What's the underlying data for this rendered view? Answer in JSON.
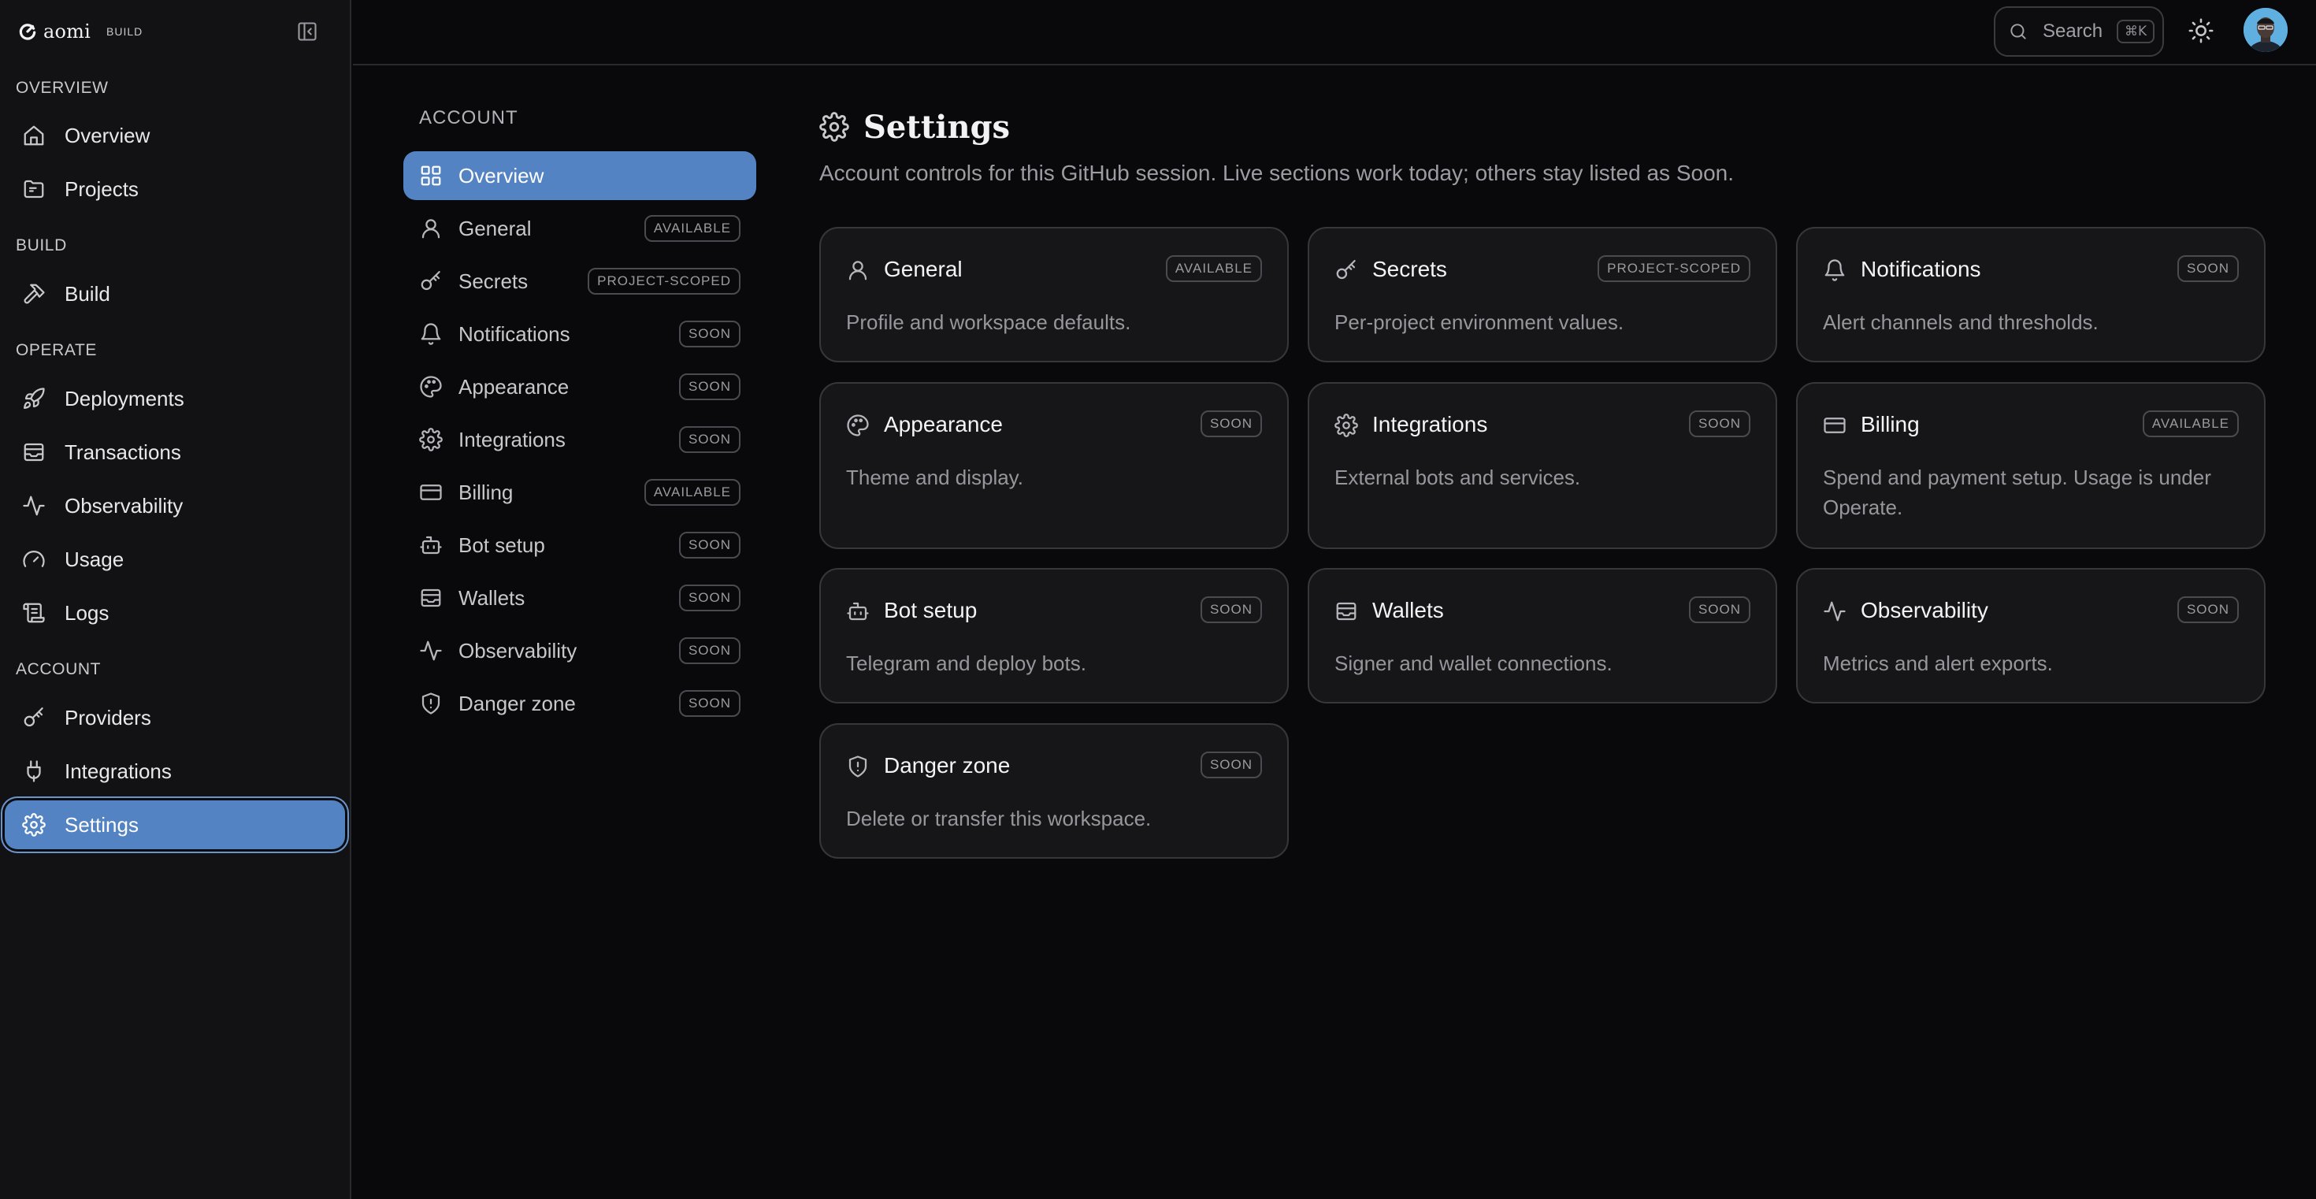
{
  "brand": {
    "name": "aomi",
    "tag": "BUILD"
  },
  "sidebar": {
    "groups": [
      {
        "label": "OVERVIEW"
      },
      {
        "label": "BUILD"
      },
      {
        "label": "OPERATE"
      },
      {
        "label": "ACCOUNT"
      }
    ],
    "items": [
      {
        "label": "Overview",
        "icon": "home-icon"
      },
      {
        "label": "Projects",
        "icon": "folder-icon"
      },
      {
        "label": "Build",
        "icon": "hammer-icon"
      },
      {
        "label": "Deployments",
        "icon": "rocket-icon"
      },
      {
        "label": "Transactions",
        "icon": "inbox-icon"
      },
      {
        "label": "Observability",
        "icon": "activity-icon"
      },
      {
        "label": "Usage",
        "icon": "gauge-icon"
      },
      {
        "label": "Logs",
        "icon": "scroll-icon"
      },
      {
        "label": "Providers",
        "icon": "key-icon"
      },
      {
        "label": "Integrations",
        "icon": "plug-icon"
      },
      {
        "label": "Settings",
        "icon": "gear-icon",
        "active": true
      }
    ]
  },
  "topbar": {
    "search_label": "Search",
    "search_shortcut": "⌘K"
  },
  "subnav": {
    "heading": "ACCOUNT",
    "items": [
      {
        "label": "Overview",
        "badge": "",
        "active": true
      },
      {
        "label": "General",
        "badge": "AVAILABLE"
      },
      {
        "label": "Secrets",
        "badge": "PROJECT-SCOPED"
      },
      {
        "label": "Notifications",
        "badge": "SOON"
      },
      {
        "label": "Appearance",
        "badge": "SOON"
      },
      {
        "label": "Integrations",
        "badge": "SOON"
      },
      {
        "label": "Billing",
        "badge": "AVAILABLE"
      },
      {
        "label": "Bot setup",
        "badge": "SOON"
      },
      {
        "label": "Wallets",
        "badge": "SOON"
      },
      {
        "label": "Observability",
        "badge": "SOON"
      },
      {
        "label": "Danger zone",
        "badge": "SOON"
      }
    ]
  },
  "main": {
    "title": "Settings",
    "subtitle": "Account controls for this GitHub session. Live sections work today; others stay listed as Soon.",
    "cards": [
      {
        "title": "General",
        "badge": "AVAILABLE",
        "desc": "Profile and workspace defaults."
      },
      {
        "title": "Secrets",
        "badge": "PROJECT-SCOPED",
        "desc": "Per-project environment values."
      },
      {
        "title": "Notifications",
        "badge": "SOON",
        "desc": "Alert channels and thresholds."
      },
      {
        "title": "Appearance",
        "badge": "SOON",
        "desc": "Theme and display."
      },
      {
        "title": "Integrations",
        "badge": "SOON",
        "desc": "External bots and services."
      },
      {
        "title": "Billing",
        "badge": "AVAILABLE",
        "desc": "Spend and payment setup. Usage is under Operate."
      },
      {
        "title": "Bot setup",
        "badge": "SOON",
        "desc": "Telegram and deploy bots."
      },
      {
        "title": "Wallets",
        "badge": "SOON",
        "desc": "Signer and wallet connections."
      },
      {
        "title": "Observability",
        "badge": "SOON",
        "desc": "Metrics and alert exports."
      },
      {
        "title": "Danger zone",
        "badge": "SOON",
        "desc": "Delete or transfer this workspace."
      }
    ]
  },
  "colors": {
    "accent": "#5383c2",
    "background": "#09090b",
    "sidebar": "#121214",
    "card": "#161618"
  }
}
